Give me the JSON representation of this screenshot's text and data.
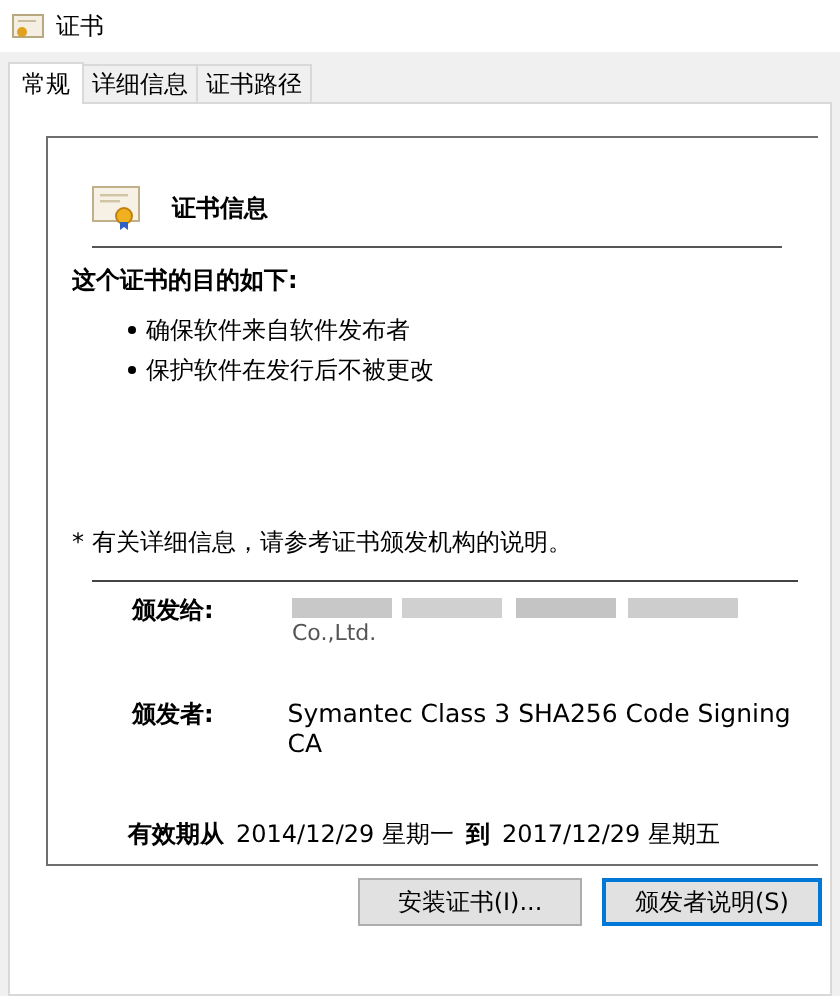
{
  "window": {
    "title": "证书"
  },
  "tabs": [
    {
      "label": "常规",
      "selected": true
    },
    {
      "label": "详细信息",
      "selected": false
    },
    {
      "label": "证书路径",
      "selected": false
    }
  ],
  "info": {
    "heading": "证书信息",
    "purpose_title": "这个证书的目的如下:",
    "purposes": [
      "确保软件来自软件发布者",
      "保护软件在发行后不被更改"
    ],
    "note": "* 有关详细信息，请参考证书颁发机构的说明。",
    "issued_to_label": "颁发给:",
    "issued_to_value": "Co.,Ltd.",
    "issued_by_label": "颁发者:",
    "issued_by_value": "Symantec Class 3 SHA256 Code Signing CA",
    "valid_from_label": "有效期从",
    "valid_from": "2014/12/29 星期一",
    "valid_to_label": "到",
    "valid_to": "2017/12/29 星期五"
  },
  "buttons": [
    {
      "label": "安装证书(I)...",
      "selected": false
    },
    {
      "label": "颁发者说明(S)",
      "selected": true
    }
  ]
}
